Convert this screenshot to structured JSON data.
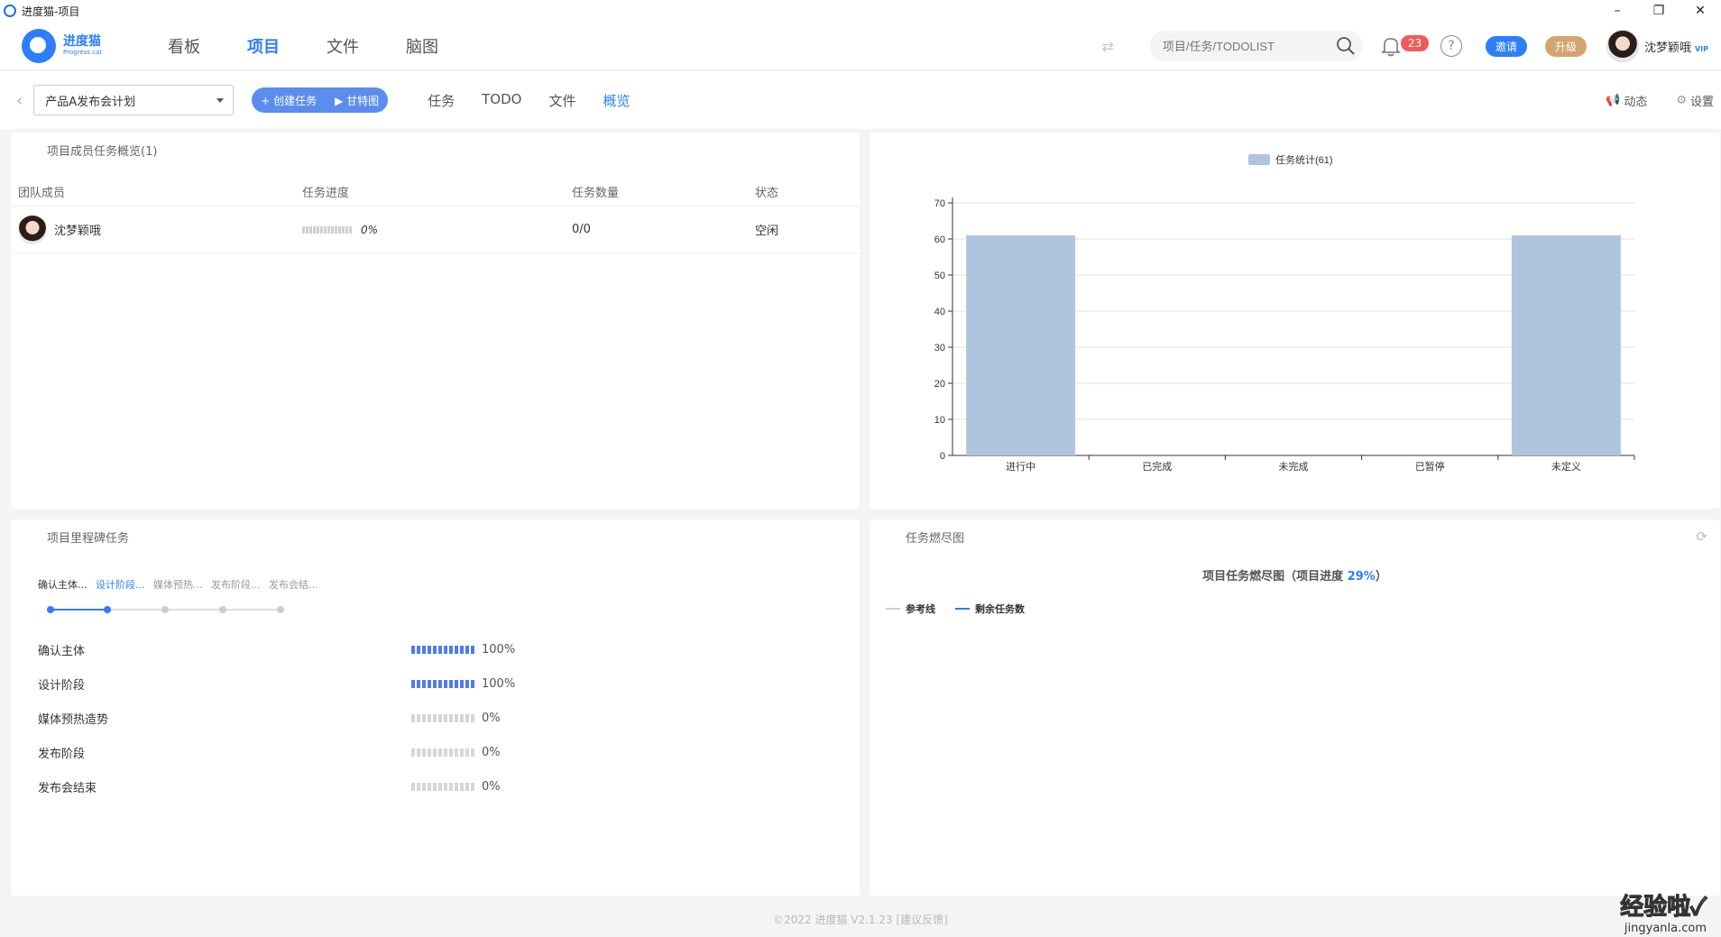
{
  "window": {
    "title": "进度猫-项目",
    "controls": [
      "–",
      "❐",
      "✕"
    ]
  },
  "header": {
    "logo_cn": "进度猫",
    "logo_en": "Progress cat",
    "nav": [
      {
        "label": "看板",
        "active": false
      },
      {
        "label": "项目",
        "active": true
      },
      {
        "label": "文件",
        "active": false
      },
      {
        "label": "脑图",
        "active": false
      }
    ],
    "search_placeholder": "项目/任务/TODOLIST",
    "notification_count": "23",
    "invite_label": "邀请",
    "upgrade_label": "升级",
    "user_name": "沈梦颖哦",
    "vip_label": "VIP"
  },
  "toolbar": {
    "project_name": "产品A发布会计划",
    "create_task_label": "+ 创建任务",
    "gantt_label": "▶ 甘特图",
    "tabs": [
      {
        "label": "任务",
        "active": false
      },
      {
        "label": "TODO",
        "active": false
      },
      {
        "label": "文件",
        "active": false
      },
      {
        "label": "概览",
        "active": true
      }
    ],
    "activity_label": "动态",
    "settings_label": "设置"
  },
  "members": {
    "title": "项目成员任务概览(1)",
    "columns": [
      "团队成员",
      "任务进度",
      "任务数量",
      "状态"
    ],
    "rows": [
      {
        "name": "沈梦颖哦",
        "progress": "0%",
        "count": "0/0",
        "status": "空闲"
      }
    ]
  },
  "chart_data": {
    "type": "bar",
    "title": "",
    "legend": [
      "任务统计(61)"
    ],
    "legend_position": "top-center",
    "categories": [
      "进行中",
      "已完成",
      "未完成",
      "已暂停",
      "未定义"
    ],
    "series": [
      {
        "name": "任务统计(61)",
        "values": [
          61,
          0,
          0,
          0,
          61
        ]
      }
    ],
    "ylim": [
      0,
      70
    ],
    "yticks": [
      0,
      10,
      20,
      30,
      40,
      50,
      60,
      70
    ],
    "grid": true,
    "color": "#b0c4de"
  },
  "milestones": {
    "title": "项目里程碑任务",
    "steps": [
      "确认主体...",
      "设计阶段...",
      "媒体预热...",
      "发布阶段...",
      "发布会结..."
    ],
    "items": [
      {
        "name": "确认主体",
        "percent": "100%",
        "value": 1.0
      },
      {
        "name": "设计阶段",
        "percent": "100%",
        "value": 1.0
      },
      {
        "name": "媒体预热造势",
        "percent": "0%",
        "value": 0
      },
      {
        "name": "发布阶段",
        "percent": "0%",
        "value": 0
      },
      {
        "name": "发布会结束",
        "percent": "0%",
        "value": 0
      }
    ]
  },
  "burndown": {
    "panel_title": "任务燃尽图",
    "chart_title_prefix": "项目任务燃尽图（项目进度 ",
    "chart_progress": "29%",
    "chart_title_suffix": "）",
    "legend_reference": "参考线",
    "legend_remaining": "剩余任务数",
    "reference_color": "#cccccc",
    "remaining_color": "#2d7ff9"
  },
  "footer": "©2022 进度猫 V2.1.23 [建议反馈]",
  "watermark": {
    "line1": "经验啦✓",
    "line2": "jingyanla.com"
  }
}
